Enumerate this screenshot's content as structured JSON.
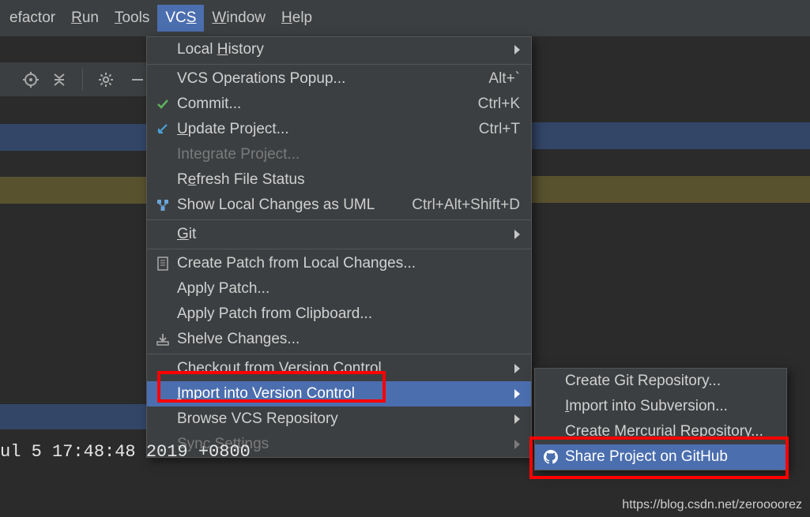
{
  "menubar": {
    "refactor": "efactor",
    "run": "Run",
    "tools": "Tools",
    "vcs": "VCS",
    "window": "Window",
    "help": "Help"
  },
  "vcs_menu": {
    "local_history": "Local History",
    "vcs_ops_popup": "VCS Operations Popup...",
    "vcs_ops_popup_sc": "Alt+`",
    "commit": "Commit...",
    "commit_sc": "Ctrl+K",
    "update_project": "Update Project...",
    "update_project_sc": "Ctrl+T",
    "integrate_project": "Integrate Project...",
    "refresh_file_status": "Refresh File Status",
    "show_local_changes_uml": "Show Local Changes as UML",
    "show_local_changes_uml_sc": "Ctrl+Alt+Shift+D",
    "git": "Git",
    "create_patch": "Create Patch from Local Changes...",
    "apply_patch": "Apply Patch...",
    "apply_patch_clip": "Apply Patch from Clipboard...",
    "shelve_changes": "Shelve Changes...",
    "checkout_vc": "Checkout from Version Control",
    "import_vc": "Import into Version Control",
    "browse_vcs_repo": "Browse VCS Repository",
    "sync_settings": "Sync Settings"
  },
  "submenu": {
    "create_git_repo": "Create Git Repository...",
    "import_svn": "Import into Subversion...",
    "create_mercurial": "Create Mercurial Repository...",
    "share_github": "Share Project on GitHub"
  },
  "terminal_text": "ul 5 17:48:48 2019 +0800",
  "watermark": "https://blog.csdn.net/zeroooorez"
}
